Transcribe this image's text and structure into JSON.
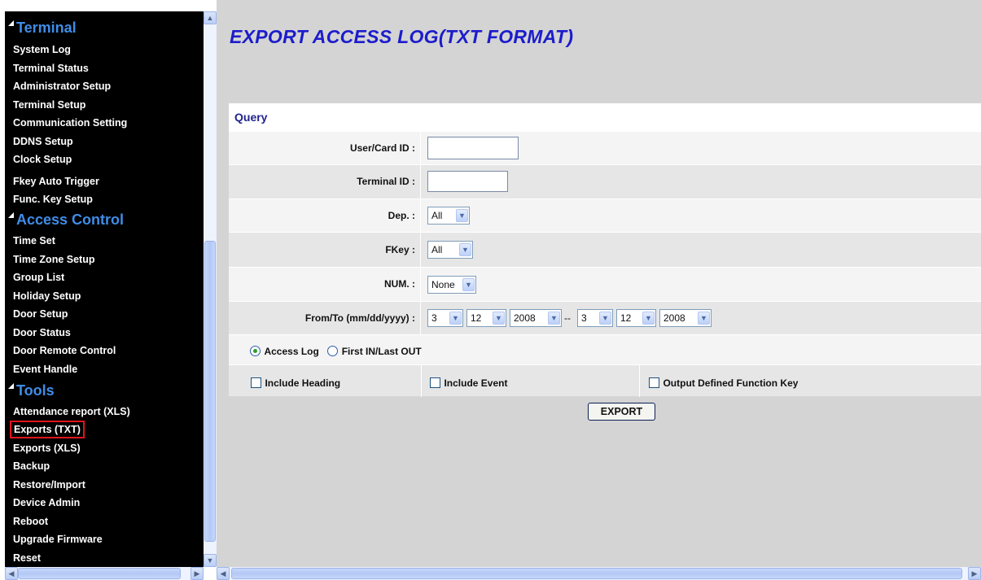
{
  "sidebar": {
    "sections": [
      {
        "title": "Terminal",
        "items": [
          "System Log",
          "Terminal Status",
          "Administrator Setup",
          "Terminal Setup",
          "Communication Setting",
          "DDNS Setup",
          "Clock Setup",
          "Fkey Auto Trigger",
          "Func. Key Setup"
        ]
      },
      {
        "title": "Access Control",
        "items": [
          "Time Set",
          "Time Zone Setup",
          "Group List",
          "Holiday Setup",
          "Door Setup",
          "Door Status",
          "Door Remote Control",
          "Event Handle"
        ]
      },
      {
        "title": "Tools",
        "items": [
          "Attendance report (XLS)",
          "Exports (TXT)",
          "Exports (XLS)",
          "Backup",
          "Restore/Import",
          "Device Admin",
          "Reboot",
          "Upgrade Firmware",
          "Reset"
        ]
      }
    ],
    "selected_item": "Exports (TXT)"
  },
  "main": {
    "title": "EXPORT ACCESS LOG(TXT FORMAT)",
    "query_header": "Query",
    "fields": {
      "user_card_id": {
        "label": "User/Card ID :",
        "value": ""
      },
      "terminal_id": {
        "label": "Terminal ID :",
        "value": ""
      },
      "dep": {
        "label": "Dep. :",
        "selected": "All"
      },
      "fkey": {
        "label": "FKey :",
        "selected": "All"
      },
      "num": {
        "label": "NUM. :",
        "selected": "None"
      },
      "from_to": {
        "label": "From/To (mm/dd/yyyy) :",
        "from_month": "3",
        "from_day": "12",
        "from_year": "2008",
        "separator": "--",
        "to_month": "3",
        "to_day": "12",
        "to_year": "2008"
      }
    },
    "log_type": {
      "access_log": {
        "label": "Access Log",
        "checked": true
      },
      "first_in_last_out": {
        "label": "First IN/Last OUT",
        "checked": false
      }
    },
    "options": {
      "include_heading": {
        "label": "Include Heading",
        "checked": false
      },
      "include_event": {
        "label": "Include Event",
        "checked": false
      },
      "output_defined_function_key": {
        "label": "Output Defined Function Key",
        "checked": false
      }
    },
    "export_button": "EXPORT"
  },
  "colors": {
    "title": "#1c1ccc",
    "section_heading": "#3f8de8",
    "selection_outline": "#e0141c",
    "sidebar_bg": "#000000",
    "content_bg": "#d4d4d4"
  },
  "icons": [
    "triangle-expand-icon",
    "scroll-up-icon",
    "scroll-down-icon",
    "scroll-left-icon",
    "scroll-right-icon",
    "dropdown-arrow-icon",
    "radio-icon",
    "checkbox-icon"
  ]
}
